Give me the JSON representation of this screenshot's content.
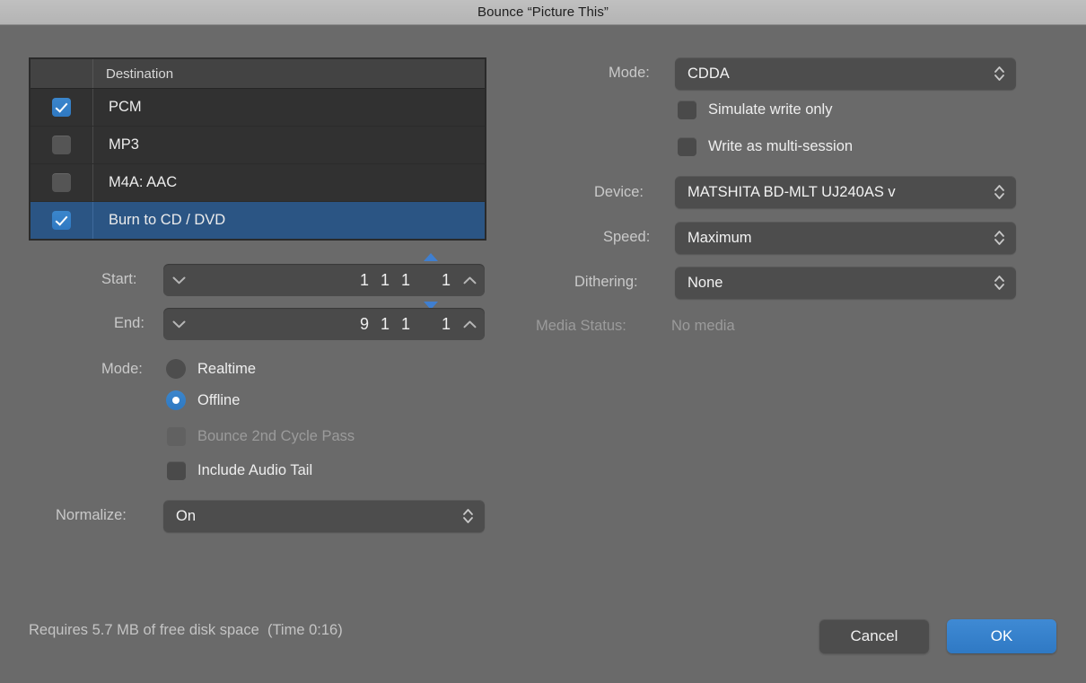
{
  "window": {
    "title": "Bounce “Picture This”"
  },
  "destination_table": {
    "header": {
      "checkbox_column": "",
      "name_column": "Destination"
    },
    "rows": [
      {
        "label": "PCM",
        "checked": true,
        "selected": false
      },
      {
        "label": "MP3",
        "checked": false,
        "selected": false
      },
      {
        "label": "M4A: AAC",
        "checked": false,
        "selected": false
      },
      {
        "label": "Burn to CD / DVD",
        "checked": true,
        "selected": true
      }
    ]
  },
  "position_fields": {
    "start": {
      "label": "Start:",
      "left_icon": "chevron-down-icon",
      "bar": "1",
      "beat": "1",
      "division": "1",
      "tick": "1",
      "right_icon": "chevron-up-icon",
      "marker": "up"
    },
    "end": {
      "label": "End:",
      "left_icon": "chevron-down-icon",
      "bar": "9",
      "beat": "1",
      "division": "1",
      "tick": "1",
      "right_icon": "chevron-up-icon",
      "marker": "down"
    }
  },
  "bounce_mode": {
    "label": "Mode:",
    "options": [
      {
        "label": "Realtime",
        "selected": false,
        "disabled": false
      },
      {
        "label": "Offline",
        "selected": true,
        "disabled": false
      }
    ],
    "checkboxes": [
      {
        "label": "Bounce 2nd Cycle Pass",
        "checked": false,
        "disabled": true
      },
      {
        "label": "Include Audio Tail",
        "checked": false,
        "disabled": false
      }
    ]
  },
  "normalize": {
    "label": "Normalize:",
    "value": "On"
  },
  "burn_panel": {
    "mode": {
      "label": "Mode:",
      "value": "CDDA"
    },
    "simulate": {
      "label": "Simulate write only",
      "checked": false
    },
    "multisession": {
      "label": "Write as multi-session",
      "checked": false
    },
    "device": {
      "label": "Device:",
      "value": "MATSHITA BD-MLT UJ240AS v"
    },
    "speed": {
      "label": "Speed:",
      "value": "Maximum"
    },
    "dithering": {
      "label": "Dithering:",
      "value": "None"
    },
    "media_status": {
      "label": "Media Status:",
      "value": "No media"
    }
  },
  "footer": {
    "status": "Requires 5.7 MB of free disk space  (Time 0:16)",
    "cancel_label": "Cancel",
    "ok_label": "OK"
  },
  "colors": {
    "accent_blue": "#3b86cc",
    "selection_blue": "#2b5584",
    "window_bg": "#6a6a6a",
    "table_bg": "#313131",
    "titlebar_bg": "#b9b9b9"
  }
}
